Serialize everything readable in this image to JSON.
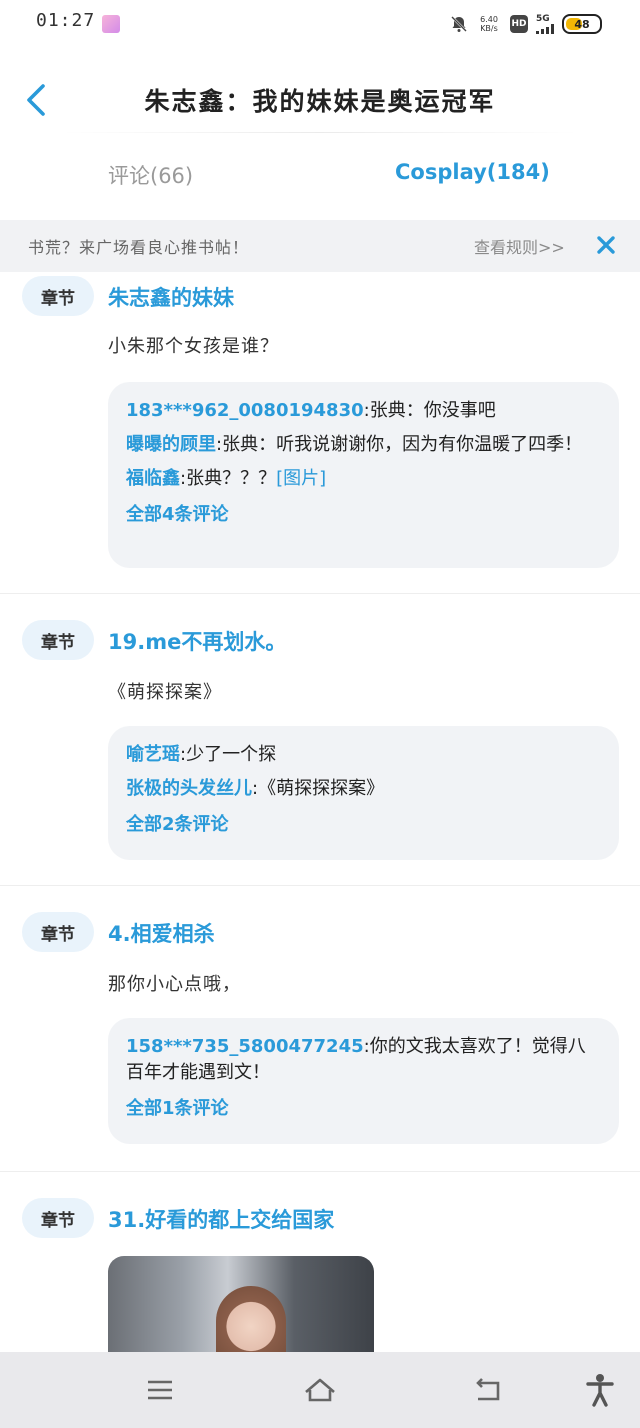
{
  "status_bar": {
    "time": "01:27",
    "net_speed_value": "6.40",
    "net_speed_unit": "KB/s",
    "hd": "HD",
    "signal": "5G",
    "battery": "48"
  },
  "header": {
    "title": "朱志鑫：我的妹妹是奥运冠军"
  },
  "tabs": [
    {
      "label": "评论(66)",
      "active": false
    },
    {
      "label": "Cosplay(184)",
      "active": true
    }
  ],
  "notice": {
    "text": "书荒？来广场看良心推书帖！",
    "rules_link": "查看规则>>"
  },
  "posts": [
    {
      "tag": "章节",
      "chapter_title": "朱志鑫的妹妹",
      "text": "小朱那个女孩是谁？",
      "replies": [
        {
          "user": "183***962_0080194830",
          "text": "张典：你没事吧"
        },
        {
          "user": "曝曝的顾里",
          "text": "张典：听我说谢谢你，因为有你温暖了四季！"
        },
        {
          "user": "福临鑫",
          "text": "张典？？？",
          "link": "[图片]"
        }
      ],
      "all_comments": "全部4条评论"
    },
    {
      "tag": "章节",
      "chapter_title": "19.me不再划水。",
      "text": "《萌探探案》",
      "replies": [
        {
          "user": "喻艺瑶",
          "text": "少了一个探"
        },
        {
          "user": "张极的头发丝儿",
          "text": "《萌探探探案》"
        }
      ],
      "all_comments": "全部2条评论"
    },
    {
      "tag": "章节",
      "chapter_title": "4.相爱相杀",
      "text": "那你小心点哦，",
      "replies": [
        {
          "user": "158***735_5800477245",
          "text": "你的文我太喜欢了！觉得八百年才能遇到文！"
        }
      ],
      "all_comments": "全部1条评论"
    },
    {
      "tag": "章节",
      "chapter_title": "31.好看的都上交给国家"
    }
  ],
  "colors": {
    "accent": "#2a9ad9",
    "tag_bg": "#e9f3fb",
    "reply_bg": "#f1f3f6",
    "notice_bg": "#f1f2f4",
    "nav_bg": "#e9e9ec"
  },
  "icons": {
    "back": "chevron-left-icon",
    "close": "close-icon",
    "nav_menu": "menu-icon",
    "nav_home": "home-icon",
    "nav_back": "return-icon",
    "nav_accessibility": "accessibility-icon"
  }
}
